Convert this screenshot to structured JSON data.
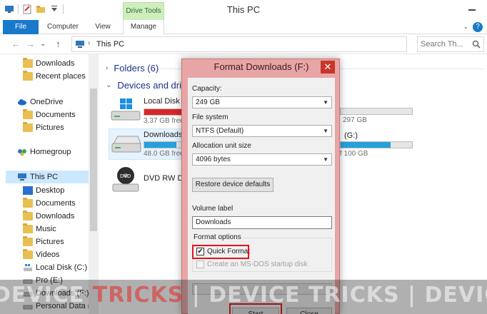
{
  "window": {
    "title": "This PC",
    "drive_tools": "Drive Tools"
  },
  "ribbon": {
    "file": "File",
    "computer": "Computer",
    "view": "View",
    "manage": "Manage",
    "help": "?",
    "collapse": "⌄"
  },
  "address": {
    "sep": "›",
    "path": "This PC",
    "search_placeholder": "Search Th...",
    "back": "←",
    "forward": "→",
    "recent": "⌄",
    "up": "↑"
  },
  "nav": {
    "downloads": "Downloads",
    "recent": "Recent places",
    "onedrive": "OneDrive",
    "od_documents": "Documents",
    "od_pictures": "Pictures",
    "homegroup": "Homegroup",
    "this_pc": "This PC",
    "desktop": "Desktop",
    "documents": "Documents",
    "downloads2": "Downloads",
    "music": "Music",
    "pictures": "Pictures",
    "videos": "Videos",
    "local_c": "Local Disk (C:)",
    "pro_e": "Pro (E:)",
    "downloads_f": "Downloads (F:)",
    "personal_g": "Personal Data (G"
  },
  "content": {
    "folders_hdr": "Folders (6)",
    "devices_hdr": "Devices and drive",
    "local_disk_name": "Local Disk (",
    "local_disk_free": "3.37 GB free",
    "local_disk_right": "297 GB",
    "downloads_name": "Downloads",
    "downloads_free": "48.0 GB free",
    "g_label": "(G:)",
    "g_right": "f 100 GB",
    "dvd_name": "DVD RW Driv",
    "dvd_label": "DVD"
  },
  "usage": {
    "local_c": 0.99,
    "downloads_f": 0.81,
    "g_drive": 0.7
  },
  "colors": {
    "accent": "#1979ca",
    "bar_blue": "#26a0da",
    "bar_red": "#da2626",
    "highlight": "#e0141b",
    "dialog_frame": "#e8a5a5"
  },
  "dialog": {
    "title": "Format Downloads (F:)",
    "close": "✕",
    "capacity_label": "Capacity:",
    "capacity_value": "249 GB",
    "fs_label": "File system",
    "fs_value": "NTFS (Default)",
    "alloc_label": "Allocation unit size",
    "alloc_value": "4096 bytes",
    "restore_btn": "Restore device defaults",
    "volume_label": "Volume label",
    "volume_value": "Downloads",
    "options_legend": "Format options",
    "quick_format": "Quick Format",
    "msdos": "Create an MS-DOS startup disk",
    "check_mark": "✔",
    "dropdown_arrow": "▼",
    "start": "Start",
    "close_btn": "Close"
  },
  "watermark": {
    "part1": "DEVICE",
    "part2": "TRICKS",
    "part3": "|",
    "part4": "DEVICE",
    "part5": "TRICKS",
    "part6": "|",
    "part7": "DEVICE"
  }
}
